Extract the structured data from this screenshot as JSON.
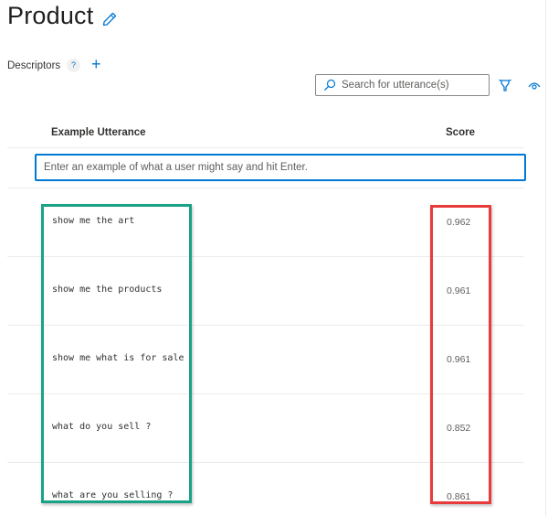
{
  "header": {
    "title": "Product",
    "edit_icon": "pencil-icon"
  },
  "descriptors": {
    "label": "Descriptors",
    "help_glyph": "?",
    "add_glyph": "+"
  },
  "toolbar": {
    "search_placeholder": "Search for utterance(s)",
    "search_value": "",
    "filter_icon": "filter-icon",
    "view_icon": "eye-icon"
  },
  "table": {
    "columns": [
      "Example Utterance",
      "Score"
    ],
    "new_utterance_placeholder": "Enter an example of what a user might say and hit Enter.",
    "rows": [
      {
        "utterance": "show me the art",
        "score": "0.962"
      },
      {
        "utterance": "show me the products",
        "score": "0.961"
      },
      {
        "utterance": "show me what is for sale",
        "score": "0.961"
      },
      {
        "utterance": "what do you sell ?",
        "score": "0.852"
      },
      {
        "utterance": "what are you selling ?",
        "score": "0.861"
      }
    ]
  },
  "annotations": {
    "utterance_highlight_color": "#1aa287",
    "score_highlight_color": "#e83b3b"
  },
  "colors": {
    "accent": "#0078d4"
  }
}
